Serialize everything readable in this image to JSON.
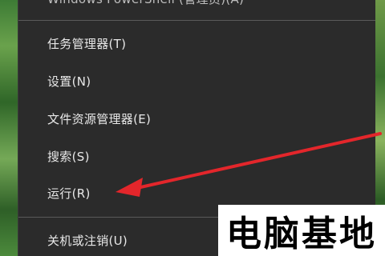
{
  "menu": {
    "items": [
      {
        "label": "Windows PowerShell (管理员)(A)"
      },
      {
        "label": "任务管理器(T)"
      },
      {
        "label": "设置(N)"
      },
      {
        "label": "文件资源管理器(E)"
      },
      {
        "label": "搜索(S)"
      },
      {
        "label": "运行(R)"
      },
      {
        "label": "关机或注销(U)"
      }
    ]
  },
  "annotation": {
    "arrow_color": "#e3262b",
    "points_to": "运行(R)"
  },
  "watermark": {
    "text": "电脑基地"
  },
  "colors": {
    "menu_bg": "#2b2b2b",
    "menu_text": "#e8e8e8",
    "separator": "#5a5a5a",
    "wallpaper": "#3d7b35"
  }
}
